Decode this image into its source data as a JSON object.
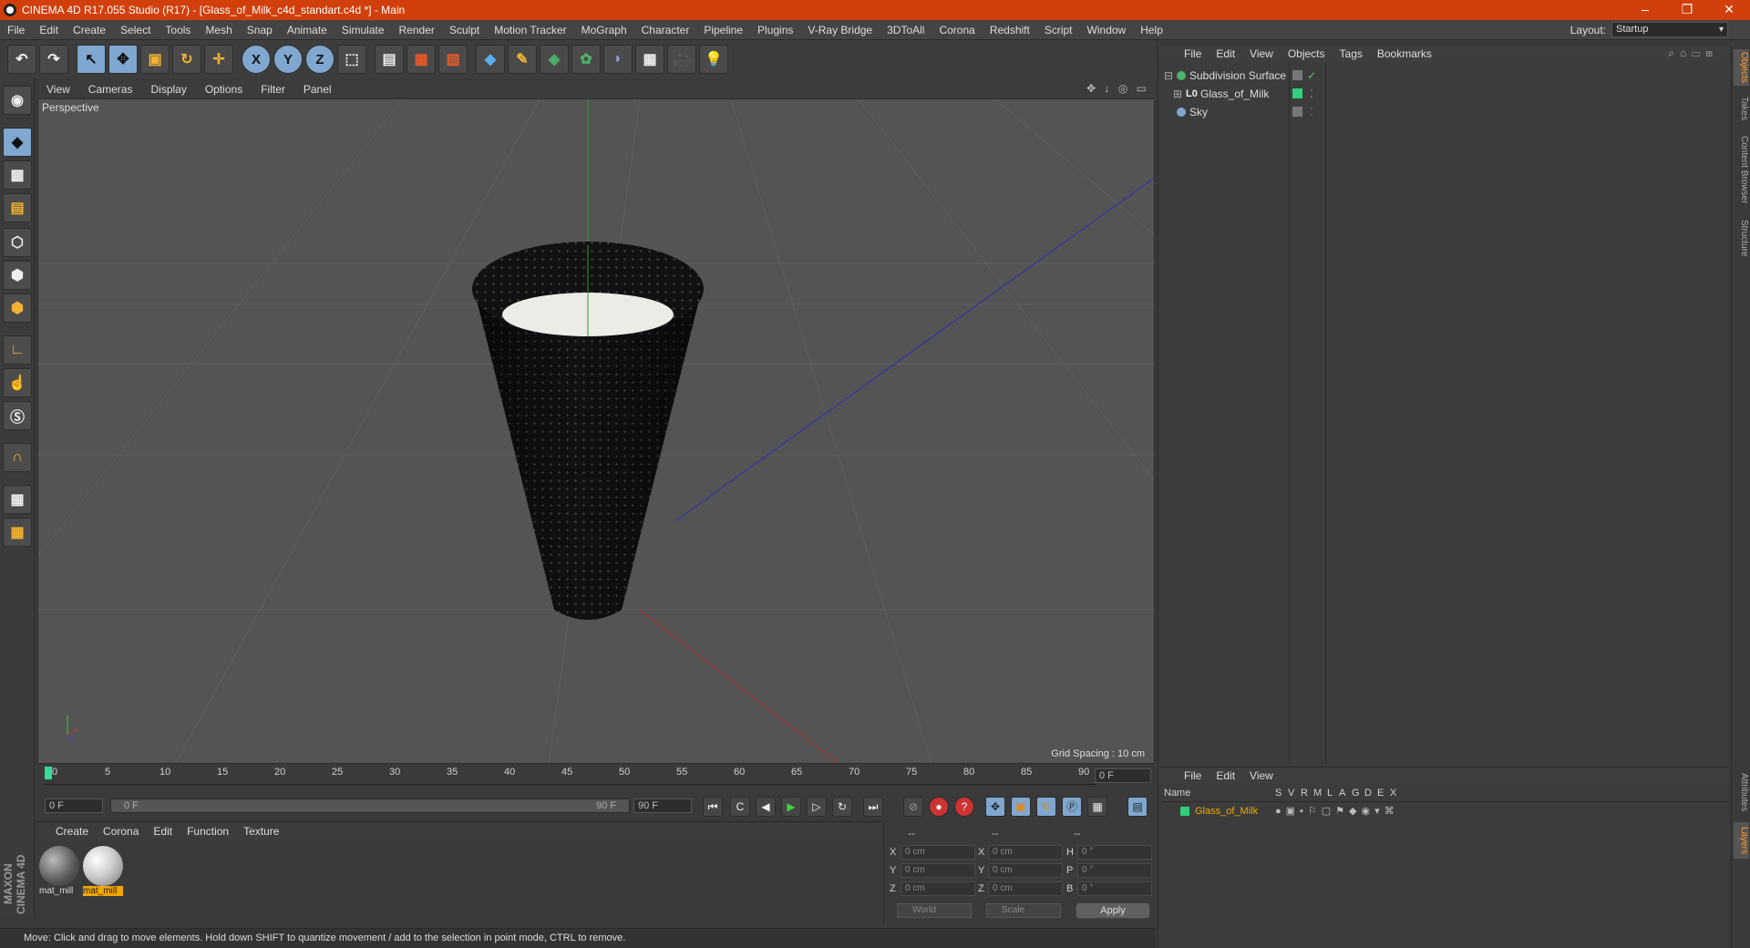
{
  "window": {
    "title": "CINEMA 4D R17.055 Studio (R17) - [Glass_of_Milk_c4d_standart.c4d *] - Main",
    "minimize": "–",
    "restore": "❐",
    "close": "✕"
  },
  "menu": [
    "File",
    "Edit",
    "Create",
    "Select",
    "Tools",
    "Mesh",
    "Snap",
    "Animate",
    "Simulate",
    "Render",
    "Sculpt",
    "Motion Tracker",
    "MoGraph",
    "Character",
    "Pipeline",
    "Plugins",
    "V-Ray Bridge",
    "3DToAll",
    "Corona",
    "Redshift",
    "Script",
    "Window",
    "Help"
  ],
  "layout": {
    "label": "Layout:",
    "value": "Startup"
  },
  "toolbar": {
    "undo": "↶",
    "redo": "↷",
    "select": "↖",
    "move": "✥",
    "scale": "▣",
    "rotate": "↻",
    "transform": "✛",
    "x": "X",
    "y": "Y",
    "z": "Z",
    "coord": "⬚",
    "render1": "▤",
    "render2": "▦",
    "render3": "▧",
    "cube": "◆",
    "pen": "✎",
    "subdiv": "◈",
    "mograph": "✿",
    "deformer": "◗",
    "grid": "▦",
    "camera": "🎥",
    "light": "💡"
  },
  "viewport": {
    "menu": [
      "View",
      "Cameras",
      "Display",
      "Options",
      "Filter",
      "Panel"
    ],
    "label": "Perspective",
    "grid_spacing": "Grid Spacing : 10 cm",
    "icons": "✥ ↓ ◎ ▭"
  },
  "timeline": {
    "ticks": [
      "0",
      "5",
      "10",
      "15",
      "20",
      "25",
      "30",
      "35",
      "40",
      "45",
      "50",
      "55",
      "60",
      "65",
      "70",
      "75",
      "80",
      "85",
      "90"
    ],
    "current": "0 F"
  },
  "playback": {
    "start": "0 F",
    "range_start": "0 F",
    "range_end": "90 F",
    "end": "90 F",
    "buttons": [
      "⏮",
      "C",
      "◀",
      "▶",
      "▷",
      "↻",
      "⏭"
    ]
  },
  "materials": {
    "menu": [
      "Create",
      "Corona",
      "Edit",
      "Function",
      "Texture"
    ],
    "items": [
      {
        "name": "mat_mill",
        "selected": false
      },
      {
        "name": "mat_mill",
        "selected": true
      }
    ]
  },
  "coords": {
    "headers": [
      "--",
      "--",
      "--"
    ],
    "rows": [
      {
        "a": "X",
        "av": "0 cm",
        "b": "X",
        "bv": "0 cm",
        "c": "H",
        "cv": "0 °"
      },
      {
        "a": "Y",
        "av": "0 cm",
        "b": "Y",
        "bv": "0 cm",
        "c": "P",
        "cv": "0 °"
      },
      {
        "a": "Z",
        "av": "0 cm",
        "b": "Z",
        "bv": "0 cm",
        "c": "B",
        "cv": "0 °"
      }
    ],
    "space": "World",
    "mode": "Scale",
    "apply": "Apply"
  },
  "status": "Move: Click and drag to move elements. Hold down SHIFT to quantize movement / add to the selection in point mode, CTRL to remove.",
  "brand": "MAXON CINEMA 4D",
  "objects": {
    "menu": [
      "File",
      "Edit",
      "View",
      "Objects",
      "Tags",
      "Bookmarks"
    ],
    "rows": [
      {
        "name": "Subdivision Surface",
        "color": "#4db36a"
      },
      {
        "name": "Glass_of_Milk",
        "color": "#2fcf7a"
      },
      {
        "name": "Sky",
        "color": "#7fa7cf"
      }
    ]
  },
  "layers": {
    "menu": [
      "File",
      "Edit",
      "View"
    ],
    "headers": [
      "Name",
      "S",
      "V",
      "R",
      "M",
      "L",
      "A",
      "G",
      "D",
      "E",
      "X"
    ],
    "rows": [
      {
        "name": "Glass_of_Milk",
        "color": "#2fcf7a"
      }
    ]
  },
  "right_tabs": [
    "Objects",
    "Takes",
    "Content Browser",
    "Structure",
    "Attributes",
    "Layers"
  ]
}
